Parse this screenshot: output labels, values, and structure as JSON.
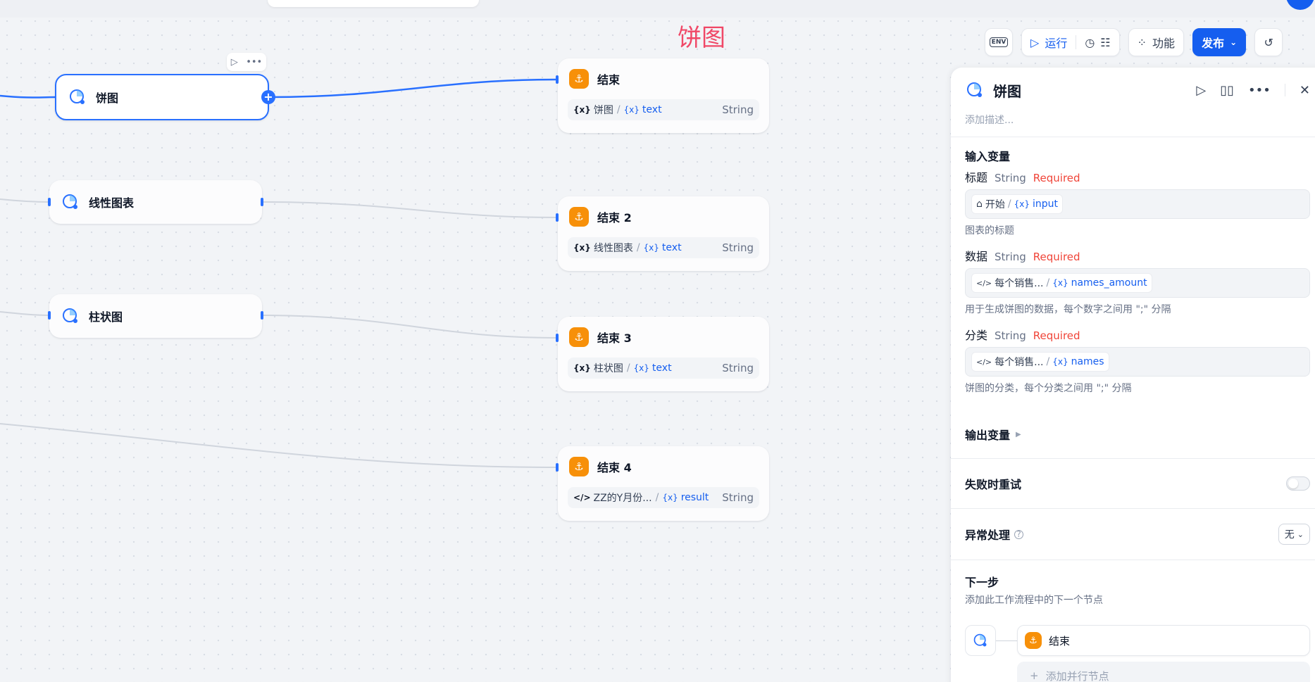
{
  "canvas": {
    "title": "饼图",
    "nodes": [
      {
        "label": "饼图"
      },
      {
        "label": "线性图表"
      },
      {
        "label": "柱状图"
      }
    ],
    "end_nodes": [
      {
        "label": "结束",
        "source": "饼图",
        "var": "text",
        "type": "String"
      },
      {
        "label": "结束 2",
        "source": "线性图表",
        "var": "text",
        "type": "String"
      },
      {
        "label": "结束 3",
        "source": "柱状图",
        "var": "text",
        "type": "String"
      },
      {
        "label": "结束 4",
        "source": "ZZ的Y月份...",
        "var": "result",
        "type": "String"
      }
    ]
  },
  "toolbar": {
    "env": "ENV",
    "run": "运行",
    "features": "功能",
    "publish": "发布"
  },
  "panel": {
    "title": "饼图",
    "description_placeholder": "添加描述...",
    "inputs_title": "输入变量",
    "fields": [
      {
        "name": "标题",
        "type": "String",
        "required": "Required",
        "chip_source": "开始",
        "chip_var": "input",
        "hint": "图表的标题"
      },
      {
        "name": "数据",
        "type": "String",
        "required": "Required",
        "chip_source": "每个销售...",
        "chip_var": "names_amount",
        "hint": "用于生成饼图的数据，每个数字之间用 \";\" 分隔"
      },
      {
        "name": "分类",
        "type": "String",
        "required": "Required",
        "chip_source": "每个销售...",
        "chip_var": "names",
        "hint": "饼图的分类，每个分类之间用 \";\" 分隔"
      }
    ],
    "outputs_title": "输出变量",
    "retry_label": "失败时重试",
    "error_label": "异常处理",
    "error_value": "无",
    "next_title": "下一步",
    "next_desc": "添加此工作流程中的下一个节点",
    "next_node": "结束",
    "add_parallel": "添加并行节点"
  },
  "colors": {
    "accent": "#155eef",
    "end_node": "#f79009",
    "title": "#f04867",
    "required": "#f04438"
  }
}
